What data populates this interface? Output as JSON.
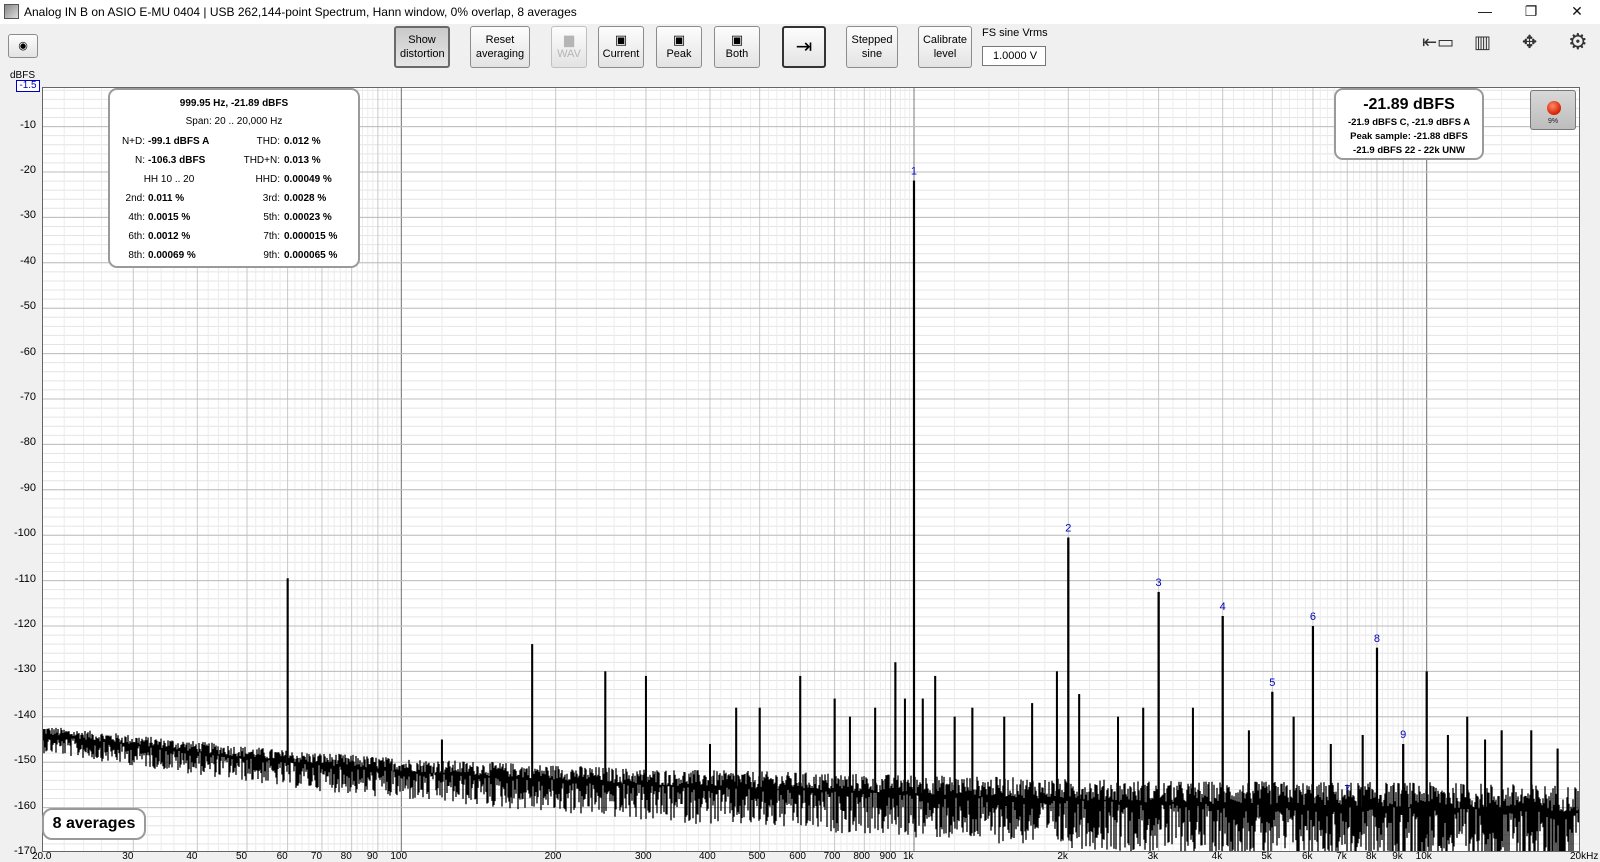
{
  "window": {
    "title": "Analog IN B on ASIO E-MU 0404 | USB 262,144-point Spectrum, Hann window, 0% overlap, 8 averages",
    "minimize": "—",
    "restore": "❐",
    "close": "✕"
  },
  "toolbar": {
    "show_distortion": "Show distortion",
    "reset_averaging": "Reset averaging",
    "wav": "WAV",
    "current": "Current",
    "peak": "Peak",
    "both": "Both",
    "stepped_sine": "Stepped sine",
    "calibrate_level": "Calibrate level",
    "fs_label": "FS sine Vrms",
    "fs_value": "1.0000 V"
  },
  "distortion_panel": {
    "header": "999.95 Hz, -21.89 dBFS",
    "span": "Span: 20 .. 20,000 Hz",
    "rows": [
      {
        "l_label": "N+D:",
        "l_value": "-99.1 dBFS A",
        "r_label": "THD:",
        "r_value": "0.012 %"
      },
      {
        "l_label": "N:",
        "l_value": "-106.3 dBFS",
        "r_label": "THD+N:",
        "r_value": "0.013 %"
      },
      {
        "l_label": "HH 10 .. 20",
        "l_value": "",
        "r_label": "HHD:",
        "r_value": "0.00049 %"
      },
      {
        "l_label": "2nd:",
        "l_value": "0.011 %",
        "r_label": "3rd:",
        "r_value": "0.0028 %"
      },
      {
        "l_label": "4th:",
        "l_value": "0.0015 %",
        "r_label": "5th:",
        "r_value": "0.00023 %"
      },
      {
        "l_label": "6th:",
        "l_value": "0.0012 %",
        "r_label": "7th:",
        "r_value": "0.000015 %"
      },
      {
        "l_label": "8th:",
        "l_value": "0.00069 %",
        "r_label": "9th:",
        "r_value": "0.000065 %"
      }
    ]
  },
  "level_panel": {
    "main": "-21.89 dBFS",
    "line1": "-21.9 dBFS C, -21.9 dBFS A",
    "line2": "Peak sample: -21.88 dBFS",
    "line3": "-21.9 dBFS 22 - 22k UNW"
  },
  "record_button": {
    "percent": "9%"
  },
  "averages_label": "8 averages",
  "colors": {
    "trace": "#000000",
    "grid": "#cfcfcf",
    "harmonic_label": "#0000c0",
    "background": "#ffffff"
  },
  "chart_data": {
    "type": "line",
    "xscale": "log",
    "xlim": [
      20,
      20000
    ],
    "ylim": [
      -170,
      -1.5
    ],
    "yunit": "dBFS",
    "ytick_values": [
      -10,
      -20,
      -30,
      -40,
      -50,
      -60,
      -70,
      -80,
      -90,
      -100,
      -110,
      -120,
      -130,
      -140,
      -150,
      -160,
      -170
    ],
    "ylim_top_label": "-1.5",
    "xtick_labels": [
      {
        "f": 20,
        "t": "20.0"
      },
      {
        "f": 30,
        "t": "30"
      },
      {
        "f": 40,
        "t": "40"
      },
      {
        "f": 50,
        "t": "50"
      },
      {
        "f": 60,
        "t": "60"
      },
      {
        "f": 70,
        "t": "70"
      },
      {
        "f": 80,
        "t": "80"
      },
      {
        "f": 90,
        "t": "90"
      },
      {
        "f": 100,
        "t": "100"
      },
      {
        "f": 200,
        "t": "200"
      },
      {
        "f": 300,
        "t": "300"
      },
      {
        "f": 400,
        "t": "400"
      },
      {
        "f": 500,
        "t": "500"
      },
      {
        "f": 600,
        "t": "600"
      },
      {
        "f": 700,
        "t": "700"
      },
      {
        "f": 800,
        "t": "800"
      },
      {
        "f": 900,
        "t": "900"
      },
      {
        "f": 1000,
        "t": "1k"
      },
      {
        "f": 2000,
        "t": "2k"
      },
      {
        "f": 3000,
        "t": "3k"
      },
      {
        "f": 4000,
        "t": "4k"
      },
      {
        "f": 5000,
        "t": "5k"
      },
      {
        "f": 6000,
        "t": "6k"
      },
      {
        "f": 7000,
        "t": "7k"
      },
      {
        "f": 8000,
        "t": "8k"
      },
      {
        "f": 9000,
        "t": "9k"
      },
      {
        "f": 10000,
        "t": "10k"
      },
      {
        "f": 20000,
        "t": "20kHz"
      }
    ],
    "ylabel": "dBFS",
    "noise_floor": [
      {
        "f": 20,
        "db": -144
      },
      {
        "f": 60,
        "db": -150
      },
      {
        "f": 100,
        "db": -152
      },
      {
        "f": 300,
        "db": -155
      },
      {
        "f": 1000,
        "db": -157
      },
      {
        "f": 3000,
        "db": -159
      },
      {
        "f": 10000,
        "db": -160
      },
      {
        "f": 20000,
        "db": -161
      }
    ],
    "spurs": [
      {
        "f": 60,
        "db": -109.5
      },
      {
        "f": 120,
        "db": -145
      },
      {
        "f": 180,
        "db": -124
      },
      {
        "f": 250,
        "db": -130
      },
      {
        "f": 300,
        "db": -131
      },
      {
        "f": 400,
        "db": -146
      },
      {
        "f": 450,
        "db": -138
      },
      {
        "f": 500,
        "db": -138
      },
      {
        "f": 600,
        "db": -131
      },
      {
        "f": 700,
        "db": -136
      },
      {
        "f": 750,
        "db": -140
      },
      {
        "f": 840,
        "db": -138
      },
      {
        "f": 920,
        "db": -128
      },
      {
        "f": 960,
        "db": -136
      },
      {
        "f": 1040,
        "db": -136
      },
      {
        "f": 1100,
        "db": -131
      },
      {
        "f": 1200,
        "db": -140
      },
      {
        "f": 1300,
        "db": -138
      },
      {
        "f": 1500,
        "db": -140
      },
      {
        "f": 1700,
        "db": -137
      },
      {
        "f": 1900,
        "db": -130
      },
      {
        "f": 2100,
        "db": -135
      },
      {
        "f": 2500,
        "db": -140
      },
      {
        "f": 2800,
        "db": -138
      },
      {
        "f": 3500,
        "db": -138
      },
      {
        "f": 4500,
        "db": -143
      },
      {
        "f": 5500,
        "db": -140
      },
      {
        "f": 6500,
        "db": -146
      },
      {
        "f": 7500,
        "db": -144
      },
      {
        "f": 11000,
        "db": -144
      },
      {
        "f": 12000,
        "db": -140
      },
      {
        "f": 13000,
        "db": -145
      },
      {
        "f": 14000,
        "db": -143
      },
      {
        "f": 16000,
        "db": -143
      },
      {
        "f": 18000,
        "db": -147
      }
    ],
    "harmonics": [
      {
        "n": "1",
        "f": 999.95,
        "db": -21.89
      },
      {
        "n": "2",
        "f": 2000,
        "db": -100.5
      },
      {
        "n": "3",
        "f": 3000,
        "db": -112.5
      },
      {
        "n": "4",
        "f": 4000,
        "db": -117.8
      },
      {
        "n": "5",
        "f": 5000,
        "db": -134.5
      },
      {
        "n": "6",
        "f": 6000,
        "db": -120
      },
      {
        "n": "7",
        "f": 7000,
        "db": -158
      },
      {
        "n": "8",
        "f": 8000,
        "db": -124.8
      },
      {
        "n": "9",
        "f": 9000,
        "db": -146
      },
      {
        "n": "",
        "f": 10000,
        "db": -130
      }
    ]
  }
}
